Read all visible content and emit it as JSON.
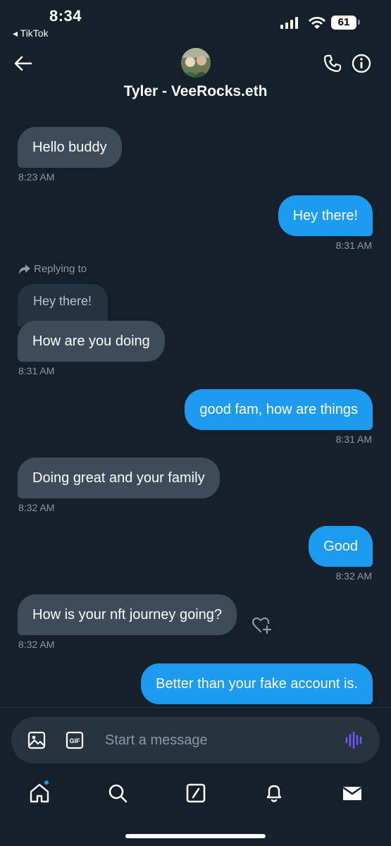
{
  "status_bar": {
    "time": "8:34",
    "back_app": "◂ TikTok",
    "battery": "61"
  },
  "header": {
    "title": "Tyler - VeeRocks.eth"
  },
  "messages": [
    {
      "text": "Hello buddy",
      "time": "8:23 AM"
    },
    {
      "text": "Hey there!",
      "time": "8:31 AM"
    },
    {
      "reply_label": "Replying to",
      "quoted": "Hey there!",
      "text": "How are you doing",
      "time": "8:31 AM"
    },
    {
      "text": "good fam, how are things",
      "time": "8:31 AM"
    },
    {
      "text": "Doing great and your family",
      "time": "8:32 AM"
    },
    {
      "text": "Good",
      "time": "8:32 AM"
    },
    {
      "text": "How is your nft journey going?",
      "time": "8:32 AM"
    },
    {
      "text": "Better than your fake account is."
    }
  ],
  "composer": {
    "placeholder": "Start a message"
  },
  "colors": {
    "background": "#15202b",
    "sent_bubble": "#1d9bf0",
    "received_bubble": "#3e4c5a",
    "voice_accent": "#7856ff"
  }
}
